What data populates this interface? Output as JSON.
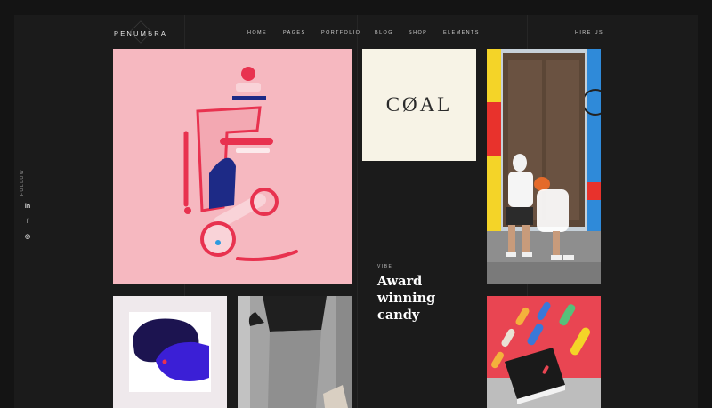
{
  "brand": {
    "name": "PENUMBRA"
  },
  "nav": {
    "items": [
      "HOME",
      "PAGES",
      "PORTFOLIO",
      "BLOG",
      "SHOP",
      "ELEMENTS"
    ],
    "cta": "HIRE US"
  },
  "sidebar": {
    "follow_label": "FOLLOW",
    "social": [
      {
        "icon": "linkedin-icon",
        "glyph": "in"
      },
      {
        "icon": "facebook-icon",
        "glyph": "f"
      },
      {
        "icon": "instagram-icon",
        "glyph": "◎"
      }
    ]
  },
  "tiles": {
    "coal_logo_text": "CØAL"
  },
  "feature": {
    "label": "VIBE",
    "headline_lines": [
      "Award",
      "winning",
      "candy"
    ]
  },
  "colors": {
    "background": "#1b1b1b",
    "pink_tile": "#f6b8c0",
    "coral_tile": "#e94552",
    "cream_tile": "#f7f3e6"
  }
}
